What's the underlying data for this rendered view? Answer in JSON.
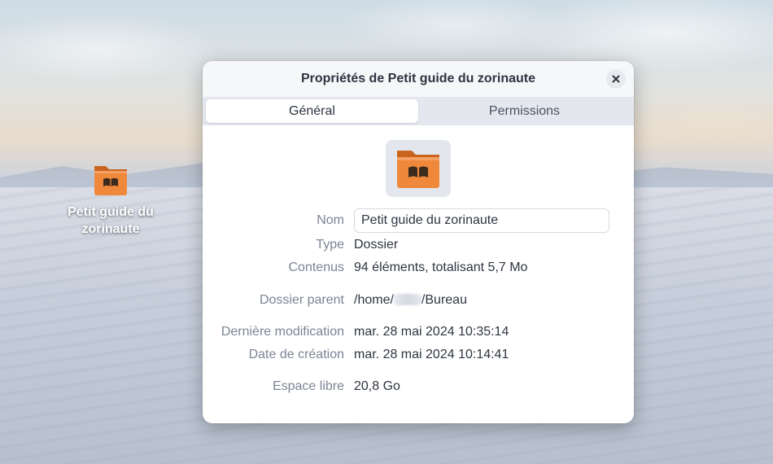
{
  "desktop": {
    "icon_label": "Petit guide du zorinaute",
    "folder_color": "#f0883c"
  },
  "dialog": {
    "title": "Propriétés de Petit guide du zorinaute",
    "tabs": [
      {
        "label": "Général",
        "active": true
      },
      {
        "label": "Permissions",
        "active": false
      }
    ],
    "fields": {
      "name_label": "Nom",
      "name_value": "Petit guide du zorinaute",
      "type_label": "Type",
      "type_value": "Dossier",
      "contents_label": "Contenus",
      "contents_value": "94 éléments, totalisant 5,7 Mo",
      "parent_label": "Dossier parent",
      "parent_prefix": "/home/",
      "parent_suffix": "/Bureau",
      "modified_label": "Dernière modification",
      "modified_value": "mar. 28 mai 2024 10:35:14",
      "created_label": "Date de création",
      "created_value": "mar. 28 mai 2024 10:14:41",
      "free_label": "Espace libre",
      "free_value": "20,8 Go"
    },
    "icons": {
      "close": "close-icon",
      "folder": "folder-book-icon"
    }
  }
}
